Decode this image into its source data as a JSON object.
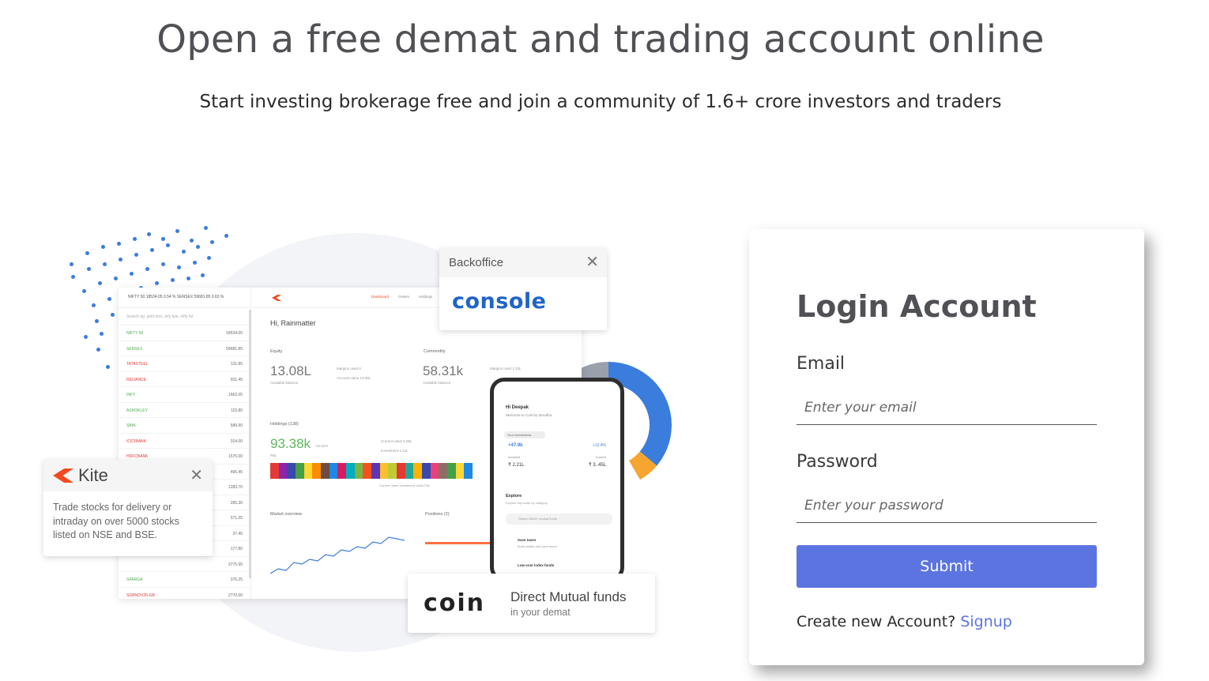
{
  "header": {
    "title": "Open a free demat and trading account online",
    "subtitle": "Start investing brokerage free and join a community of 1.6+ crore investors and traders"
  },
  "hero": {
    "dashboard": {
      "topbar": "NIFTY 50  18534.05  0.54 %     SENSEX  59681.85  0.63 %",
      "search": "Search eg: gold mcx, infy bse, nifty fut",
      "watchlist": [
        {
          "name": "NIFTY 50",
          "value": "18534.05",
          "trend": "up"
        },
        {
          "name": "SENSEX",
          "value": "59681.85",
          "trend": "up"
        },
        {
          "name": "TATASTEEL",
          "value": "131.85",
          "trend": "down"
        },
        {
          "name": "RELIANCE",
          "value": "921.45",
          "trend": "down"
        },
        {
          "name": "INFY",
          "value": "1662.05",
          "trend": "up"
        },
        {
          "name": "ASHOKLEY",
          "value": "115.80",
          "trend": "up"
        },
        {
          "name": "SBIN",
          "value": "589.90",
          "trend": "up"
        },
        {
          "name": "ICICIBANK",
          "value": "314.00",
          "trend": "down"
        },
        {
          "name": "HDFCBANK",
          "value": "1575.00",
          "trend": "down"
        },
        {
          "name": "",
          "value": "465.45",
          "trend": "down"
        },
        {
          "name": "",
          "value": "1283.70",
          "trend": "up"
        },
        {
          "name": "",
          "value": "265.30",
          "trend": "down"
        },
        {
          "name": "",
          "value": "571.25",
          "trend": "up"
        },
        {
          "name": "",
          "value": "37.45",
          "trend": "up"
        },
        {
          "name": "",
          "value": "177.80",
          "trend": "down"
        },
        {
          "name": "",
          "value": "3775.95",
          "trend": "up"
        },
        {
          "name": "SPARGA",
          "value": "376.25",
          "trend": "up"
        },
        {
          "name": "SGBNOV26-GB",
          "value": "2770.00",
          "trend": "down"
        }
      ],
      "nav_links": [
        "Dashboard",
        "Orders",
        "Holdings"
      ],
      "greeting": "Hi, Rainmatter",
      "equity_label": "Equity",
      "equity_value": "13.08L",
      "equity_caption": "Available balance",
      "equity_margins": "Margins used   0",
      "equity_account": "Account value   13.08L",
      "commodity_label": "Commodity",
      "commodity_value": "58.31k",
      "commodity_caption": "Available balance",
      "commodity_margins": "Margins used   1.33L",
      "holdings_label": "Holdings (138)",
      "holdings_value": "93.38k",
      "holdings_pct": "22.61%",
      "holdings_pl": "P&L",
      "holdings_current": "Current value   5.08L",
      "holdings_investment": "Investment   4.14L",
      "treemap_legend": "Current Value   Investment Value   P&L",
      "market_label": "Market overview",
      "positions_label": "Positions (2)"
    },
    "phone": {
      "greeting": "Hi Deepak",
      "welcome": "Welcome to Coin by Zerodha",
      "pill": "Your investments",
      "gain": "+47.9k",
      "gain_pct": "+12.4%",
      "invested_label": "Invested",
      "invested_value": "₹ 2.21L",
      "current_label": "Current",
      "current_value": "₹ 3..45L",
      "explore_title": "Explore",
      "explore_sub": "Explore top funds by category",
      "search": "Search 3000+ mutual funds",
      "item1_title": "Save taxes",
      "item1_sub": "Build wealth and save taxes",
      "item2_title": "Low-cost index funds"
    },
    "console_card": {
      "header": "Backoffice",
      "logo": "console"
    },
    "kite_card": {
      "header": "Kite",
      "description": "Trade stocks for delivery or intraday on over 5000 stocks listed on NSE and BSE."
    },
    "coin_card": {
      "logo": "coin",
      "title": "Direct Mutual funds",
      "subtitle": "in your demat"
    },
    "treemap_colors": [
      "#e53935",
      "#8e24aa",
      "#3949ab",
      "#43a047",
      "#fdd835",
      "#fb8c00",
      "#6d4c41",
      "#1e88e5",
      "#d81b60",
      "#00acc1",
      "#7cb342",
      "#f4511e",
      "#5e35b1",
      "#fbc02d",
      "#c0ca33",
      "#e53935",
      "#26a69a",
      "#ffb300",
      "#3949ab",
      "#ec407a",
      "#8d6e63",
      "#43a047",
      "#fdd835",
      "#1e88e5"
    ],
    "chart_points": [
      [
        0,
        62
      ],
      [
        10,
        56
      ],
      [
        20,
        58
      ],
      [
        30,
        48
      ],
      [
        40,
        50
      ],
      [
        50,
        44
      ],
      [
        60,
        46
      ],
      [
        70,
        38
      ],
      [
        80,
        40
      ],
      [
        90,
        32
      ],
      [
        100,
        34
      ],
      [
        110,
        28
      ],
      [
        120,
        30
      ],
      [
        130,
        22
      ],
      [
        140,
        24
      ],
      [
        150,
        16
      ],
      [
        160,
        18
      ],
      [
        170,
        20
      ]
    ]
  },
  "login": {
    "title": "Login Account",
    "email_label": "Email",
    "email_placeholder": "Enter your email",
    "password_label": "Password",
    "password_placeholder": "Enter your password",
    "submit_label": "Submit",
    "signup_prompt": "Create new Account?",
    "signup_link": "Signup"
  },
  "colors": {
    "accent": "#5c74e0",
    "kite": "#f5491f",
    "console": "#1f64c8",
    "dots": "#3b7ddd"
  },
  "icons": {
    "close": "close-icon",
    "kite_logo": "kite-logo-icon",
    "search": "search-icon"
  }
}
